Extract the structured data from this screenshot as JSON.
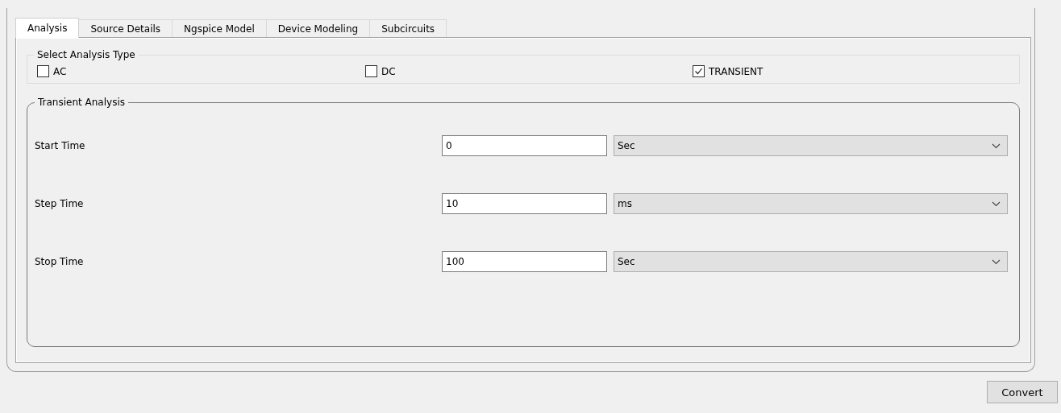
{
  "tabs": [
    {
      "label": "Analysis",
      "selected": true
    },
    {
      "label": "Source Details",
      "selected": false
    },
    {
      "label": "Ngspice Model",
      "selected": false
    },
    {
      "label": "Device Modeling",
      "selected": false
    },
    {
      "label": "Subcircuits",
      "selected": false
    }
  ],
  "analysis_type": {
    "title": "Select Analysis Type",
    "options": [
      {
        "label": "AC",
        "checked": false
      },
      {
        "label": "DC",
        "checked": false
      },
      {
        "label": "TRANSIENT",
        "checked": true
      }
    ]
  },
  "transient": {
    "title": "Transient Analysis",
    "rows": [
      {
        "label": "Start Time",
        "value": "0",
        "unit": "Sec"
      },
      {
        "label": "Step Time",
        "value": "10",
        "unit": "ms"
      },
      {
        "label": "Stop Time",
        "value": "100",
        "unit": "Sec"
      }
    ]
  },
  "buttons": [
    "Convert"
  ]
}
